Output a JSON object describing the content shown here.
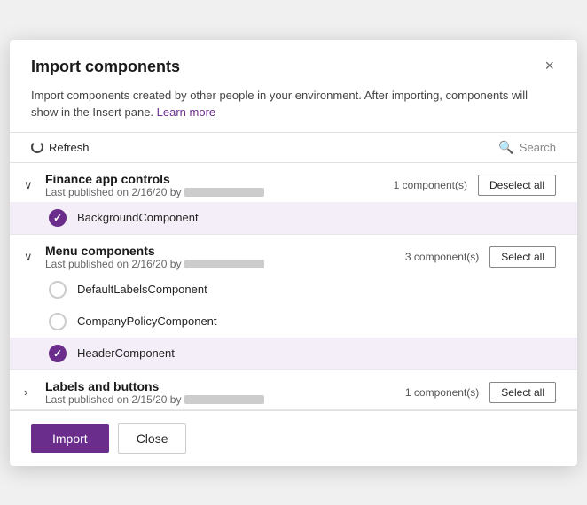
{
  "dialog": {
    "title": "Import components",
    "description": "Import components created by other people in your environment. After importing, components will show in the Insert pane.",
    "learn_more": "Learn more",
    "close_label": "×",
    "toolbar": {
      "refresh_label": "Refresh",
      "search_placeholder": "Search"
    },
    "groups": [
      {
        "id": "finance",
        "title": "Finance app controls",
        "published": "Last published on 2/16/20 by",
        "count": "1 component(s)",
        "action_label": "Deselect all",
        "expanded": true,
        "components": [
          {
            "name": "BackgroundComponent",
            "selected": true
          }
        ]
      },
      {
        "id": "menu",
        "title": "Menu components",
        "published": "Last published on 2/16/20 by",
        "count": "3 component(s)",
        "action_label": "Select all",
        "expanded": true,
        "components": [
          {
            "name": "DefaultLabelsComponent",
            "selected": false
          },
          {
            "name": "CompanyPolicyComponent",
            "selected": false
          },
          {
            "name": "HeaderComponent",
            "selected": true
          }
        ]
      },
      {
        "id": "labels",
        "title": "Labels and buttons",
        "published": "Last published on 2/15/20 by",
        "count": "1 component(s)",
        "action_label": "Select all",
        "expanded": false,
        "components": []
      }
    ],
    "footer": {
      "import_label": "Import",
      "close_label": "Close"
    }
  }
}
